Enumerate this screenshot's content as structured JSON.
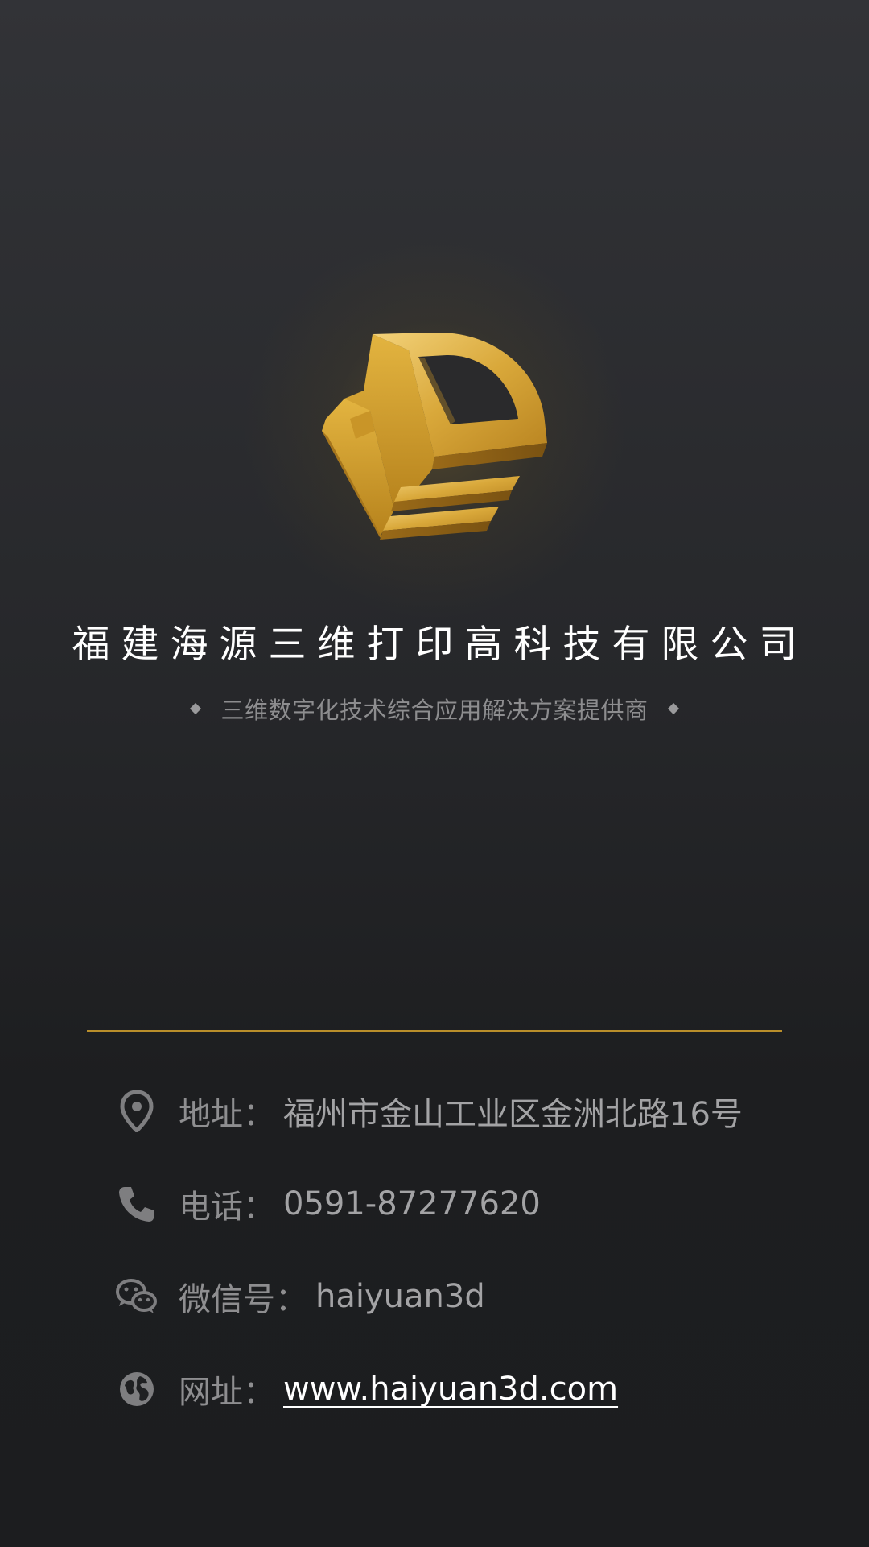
{
  "logo": {
    "name": "haiyuan-3d-logo"
  },
  "company": {
    "name": "福建海源三维打印高科技有限公司",
    "tagline": "三维数字化技术综合应用解决方案提供商"
  },
  "contacts": {
    "address": {
      "label": "地址",
      "sep": "：",
      "value": "福州市金山工业区金洲北路16号",
      "icon": "location-pin-icon"
    },
    "phone": {
      "label": "电话",
      "sep": "：",
      "value": "0591-87277620",
      "icon": "phone-icon"
    },
    "wechat": {
      "label": "微信号",
      "sep": "：",
      "value": "haiyuan3d",
      "icon": "wechat-icon"
    },
    "website": {
      "label": "网址",
      "sep": "：",
      "value": "www.haiyuan3d.com",
      "icon": "globe-icon"
    }
  },
  "colors": {
    "background": "#1c1d1f",
    "accent_gold": "#b98e2b",
    "title": "#ffffff",
    "muted_text": "#9a9a9c"
  }
}
